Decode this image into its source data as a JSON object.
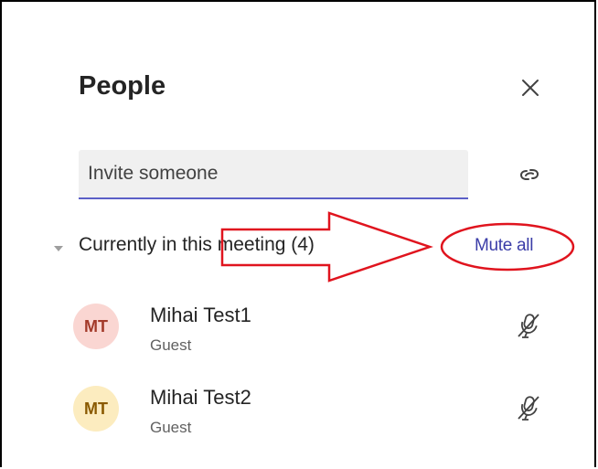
{
  "panel": {
    "title": "People",
    "close_icon": "close-icon",
    "link_icon": "link-icon"
  },
  "invite": {
    "placeholder": "Invite someone"
  },
  "section": {
    "label": "Currently in this meeting (4)",
    "chevron_icon": "chevron-down-icon",
    "mute_all_label": "Mute all"
  },
  "participants": [
    {
      "initials": "MT",
      "name": "Mihai Test1",
      "role": "Guest",
      "avatar_bg": "#fad6d2",
      "avatar_fg": "#a33a2a",
      "mic_icon": "mic-off-icon"
    },
    {
      "initials": "MT",
      "name": "Mihai Test2",
      "role": "Guest",
      "avatar_bg": "#fcecbf",
      "avatar_fg": "#8a5a00",
      "mic_icon": "mic-off-icon"
    }
  ],
  "colors": {
    "accent": "#5b5fc7",
    "link": "#3b3da8",
    "annotation_red": "#e0141e"
  }
}
